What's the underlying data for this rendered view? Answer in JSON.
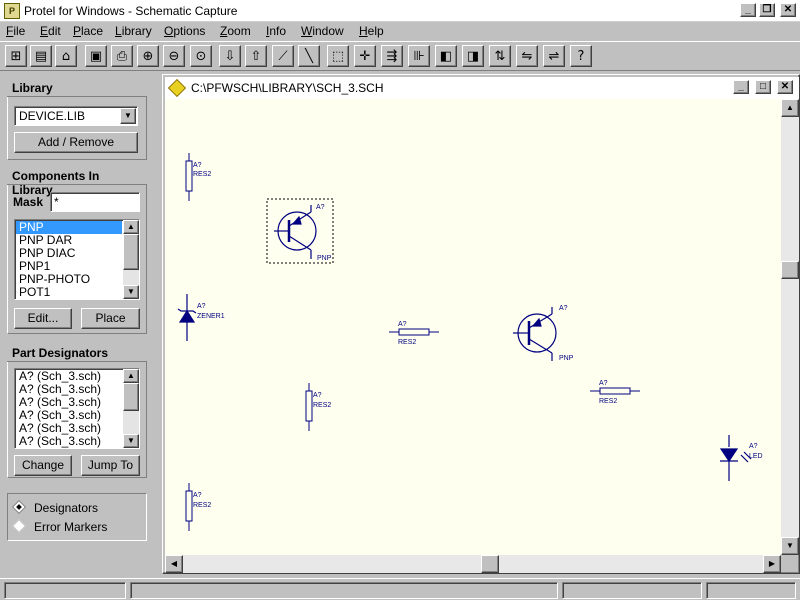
{
  "window": {
    "title": "Protel for Windows - Schematic Capture",
    "icon_name": "protel-app-icon",
    "controls": [
      "minimize",
      "restore",
      "close"
    ]
  },
  "menu": [
    {
      "label": "File",
      "ul": "F",
      "rest": "ile"
    },
    {
      "label": "Edit",
      "ul": "E",
      "rest": "dit"
    },
    {
      "label": "Place",
      "ul": "P",
      "rest": "lace"
    },
    {
      "label": "Library",
      "ul": "L",
      "rest": "ibrary"
    },
    {
      "label": "Options",
      "ul": "O",
      "rest": "ptions"
    },
    {
      "label": "Zoom",
      "ul": "Z",
      "rest": "oom"
    },
    {
      "label": "Info",
      "ul": "I",
      "rest": "nfo"
    },
    {
      "label": "Window",
      "ul": "W",
      "rest": "indow"
    },
    {
      "label": "Help",
      "ul": "H",
      "rest": "elp"
    }
  ],
  "toolbar": {
    "buttons": [
      {
        "name": "new-sheet-icon",
        "glyph": "⊞"
      },
      {
        "name": "open-project-icon",
        "glyph": "▤"
      },
      {
        "name": "open-file-icon",
        "glyph": "⌂"
      },
      {
        "name": "save-icon",
        "glyph": "▣"
      },
      {
        "name": "print-icon",
        "glyph": "⎙"
      },
      {
        "name": "zoom-in-icon",
        "glyph": "⊕"
      },
      {
        "name": "zoom-out-icon",
        "glyph": "⊖"
      },
      {
        "name": "zoom-fit-icon",
        "glyph": "⊙"
      },
      {
        "name": "move-down-icon",
        "glyph": "⇩"
      },
      {
        "name": "move-up-icon",
        "glyph": "⇧"
      },
      {
        "name": "wire-tool-icon",
        "glyph": "⟋"
      },
      {
        "name": "bus-tool-icon",
        "glyph": "╲"
      },
      {
        "name": "select-area-icon",
        "glyph": "⬚"
      },
      {
        "name": "crosshair-icon",
        "glyph": "✛"
      },
      {
        "name": "port-icon",
        "glyph": "⇶"
      },
      {
        "name": "part-icon",
        "glyph": "⊪"
      },
      {
        "name": "library-book-icon",
        "glyph": "◧"
      },
      {
        "name": "library-edit-icon",
        "glyph": "◨"
      },
      {
        "name": "netlist-icon",
        "glyph": "⇅"
      },
      {
        "name": "annotate-icon",
        "glyph": "⇋"
      },
      {
        "name": "erc-icon",
        "glyph": "⇌"
      },
      {
        "name": "help-icon",
        "glyph": "?"
      }
    ]
  },
  "library_panel": {
    "header": "Library",
    "selected_library": "DEVICE.LIB",
    "add_remove_label": "Add / Remove"
  },
  "components_panel": {
    "header": "Components In Library",
    "mask_label": "Mask",
    "mask_value": "*",
    "items": [
      "PNP",
      "PNP DAR",
      "PNP DIAC",
      "PNP1",
      "PNP-PHOTO",
      "POT1"
    ],
    "selected_index": 0,
    "edit_label": "Edit...",
    "place_label": "Place"
  },
  "designators_panel": {
    "header": "Part Designators",
    "items": [
      "A? (Sch_3.sch)",
      "A? (Sch_3.sch)",
      "A? (Sch_3.sch)",
      "A? (Sch_3.sch)",
      "A? (Sch_3.sch)",
      "A? (Sch_3.sch)"
    ],
    "change_label": "Change",
    "jump_label": "Jump To"
  },
  "view_options": {
    "designators_label": "Designators",
    "error_markers_label": "Error Markers",
    "selected": "Designators"
  },
  "document": {
    "title": "C:\\PFWSCH\\LIBRARY\\SCH_3.SCH",
    "background_color": "#fffff0",
    "symbol_color": "#000080",
    "components": [
      {
        "kind": "resistor-vertical",
        "designator": "A?",
        "part": "RES2"
      },
      {
        "kind": "pnp",
        "designator": "A?",
        "part": "PNP",
        "selected": true
      },
      {
        "kind": "zener",
        "designator": "A?",
        "part": "ZENER1"
      },
      {
        "kind": "resistor-horizontal",
        "designator": "A?",
        "part": "RES2"
      },
      {
        "kind": "pnp",
        "designator": "A?",
        "part": "PNP"
      },
      {
        "kind": "resistor-vertical",
        "designator": "A?",
        "part": "RES2"
      },
      {
        "kind": "resistor-horizontal",
        "designator": "A?",
        "part": "RES2"
      },
      {
        "kind": "led",
        "designator": "A?",
        "part": "LED"
      },
      {
        "kind": "resistor-vertical",
        "designator": "A?",
        "part": "RES2"
      }
    ]
  }
}
